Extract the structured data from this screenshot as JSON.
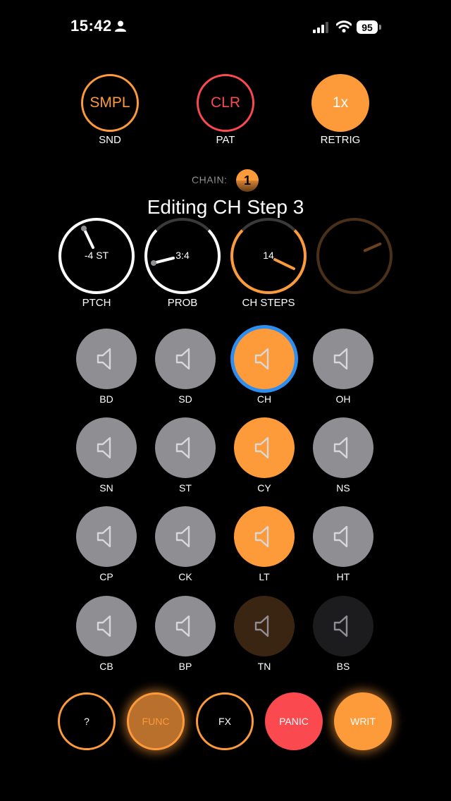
{
  "status": {
    "time": "15:42",
    "battery": "95"
  },
  "top_buttons": [
    {
      "label": "SMPL",
      "caption": "SND"
    },
    {
      "label": "CLR",
      "caption": "PAT"
    },
    {
      "label": "1x",
      "caption": "RETRIG"
    }
  ],
  "chain": {
    "label": "CHAIN:",
    "value": "1"
  },
  "title": "Editing CH Step 3",
  "knobs": [
    {
      "value": "-4 ST",
      "caption": "PTCH"
    },
    {
      "value": "3:4",
      "caption": "PROB"
    },
    {
      "value": "14",
      "caption": "CH STEPS"
    },
    {
      "value": "",
      "caption": ""
    }
  ],
  "pads": [
    {
      "label": "BD",
      "state": "grey"
    },
    {
      "label": "SD",
      "state": "grey"
    },
    {
      "label": "CH",
      "state": "orange-selected"
    },
    {
      "label": "OH",
      "state": "grey"
    },
    {
      "label": "SN",
      "state": "grey"
    },
    {
      "label": "ST",
      "state": "grey"
    },
    {
      "label": "CY",
      "state": "orange"
    },
    {
      "label": "NS",
      "state": "grey"
    },
    {
      "label": "CP",
      "state": "grey"
    },
    {
      "label": "CK",
      "state": "grey"
    },
    {
      "label": "LT",
      "state": "orange"
    },
    {
      "label": "HT",
      "state": "grey"
    },
    {
      "label": "CB",
      "state": "grey"
    },
    {
      "label": "BP",
      "state": "grey"
    },
    {
      "label": "TN",
      "state": "dark-brown"
    },
    {
      "label": "BS",
      "state": "dark"
    }
  ],
  "bottom_buttons": [
    {
      "label": "?"
    },
    {
      "label": "FUNC"
    },
    {
      "label": "FX"
    },
    {
      "label": "PANIC"
    },
    {
      "label": "WRIT"
    }
  ],
  "colors": {
    "accent": "#fd9a3a",
    "danger": "#fa4a50",
    "selected_ring": "#2d8ef0",
    "pad_grey": "#8e8e93"
  },
  "icons": [
    "person-icon",
    "signal-icon",
    "wifi-icon",
    "speaker-icon"
  ]
}
